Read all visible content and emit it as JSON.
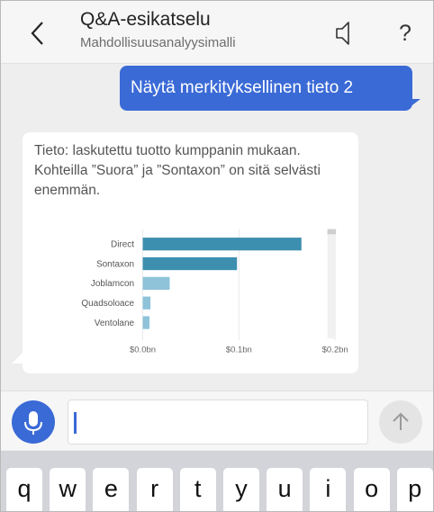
{
  "header": {
    "title": "Q&A-esikatselu",
    "subtitle": "Mahdollisuusanalyysimalli",
    "help_label": "?"
  },
  "chat": {
    "user_message": "Näytä merkityksellinen tieto 2",
    "bot_message": "Tieto: laskutettu tuotto kumppanin mukaan. Kohteilla ”Suora” ja ”Sontaxon” on sitä selvästi enemmän."
  },
  "chart_data": {
    "type": "bar",
    "orientation": "horizontal",
    "categories": [
      "Direct",
      "Sontaxon",
      "Joblamcon",
      "Quadsoloace",
      "Ventolane"
    ],
    "values": [
      0.165,
      0.098,
      0.028,
      0.008,
      0.007
    ],
    "x_ticks": [
      "$0.0bn",
      "$0.1bn",
      "$0.2bn"
    ],
    "xlim": [
      0,
      0.2
    ],
    "grid": true,
    "colors": [
      "#3d8fb0",
      "#3d8fb0",
      "#8ec3d9",
      "#8ec3d9",
      "#8ec3d9"
    ]
  },
  "input": {
    "value": "",
    "placeholder": ""
  },
  "keyboard": {
    "keys": [
      "q",
      "w",
      "e",
      "r",
      "t",
      "y",
      "u",
      "i",
      "o",
      "p"
    ]
  },
  "colors": {
    "accent": "#3a6ad6",
    "chat_background": "#eeeeee",
    "keyboard_background": "#d2d4d9"
  }
}
